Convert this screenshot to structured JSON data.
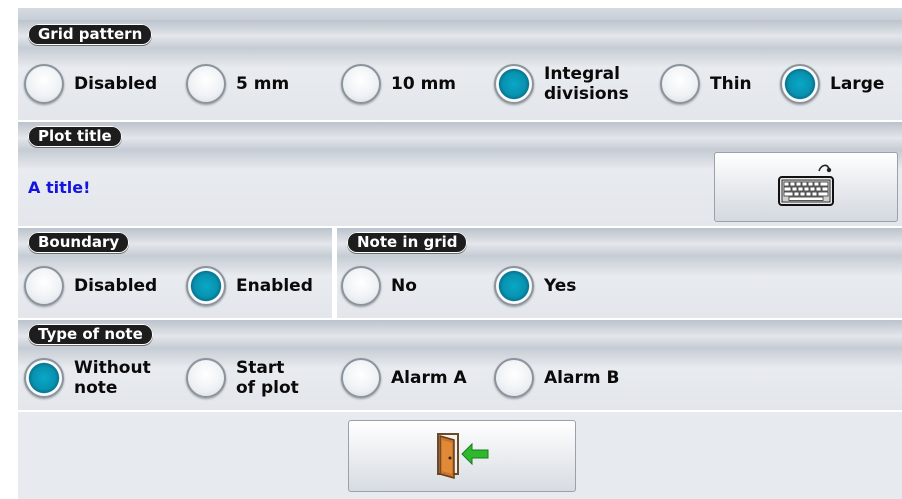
{
  "grid_pattern": {
    "title": "Grid pattern",
    "options": [
      {
        "label": "Disabled",
        "checked": false
      },
      {
        "label": "5 mm",
        "checked": false
      },
      {
        "label": "10 mm",
        "checked": false
      },
      {
        "label": "Integral\ndivisions",
        "checked": true
      },
      {
        "label": "Thin",
        "checked": false
      },
      {
        "label": "Large",
        "checked": true
      }
    ]
  },
  "plot_title": {
    "title": "Plot title",
    "value": "A title!",
    "value_color": "#1515e0",
    "keyboard_icon": "keyboard-icon"
  },
  "boundary": {
    "title": "Boundary",
    "options": [
      {
        "label": "Disabled",
        "checked": false
      },
      {
        "label": "Enabled",
        "checked": true
      }
    ]
  },
  "note_in_grid": {
    "title": "Note in grid",
    "options": [
      {
        "label": "No",
        "checked": false
      },
      {
        "label": "Yes",
        "checked": true
      }
    ]
  },
  "type_of_note": {
    "title": "Type of note",
    "options": [
      {
        "label": "Without\nnote",
        "checked": true
      },
      {
        "label": "Start\nof plot",
        "checked": false
      },
      {
        "label": "Alarm A",
        "checked": false
      },
      {
        "label": "Alarm B",
        "checked": false
      }
    ]
  },
  "exit": {
    "icon": "exit-door-icon"
  },
  "colors": {
    "accent": "#0aa7c7",
    "tab_bg": "#1d1d1d"
  }
}
